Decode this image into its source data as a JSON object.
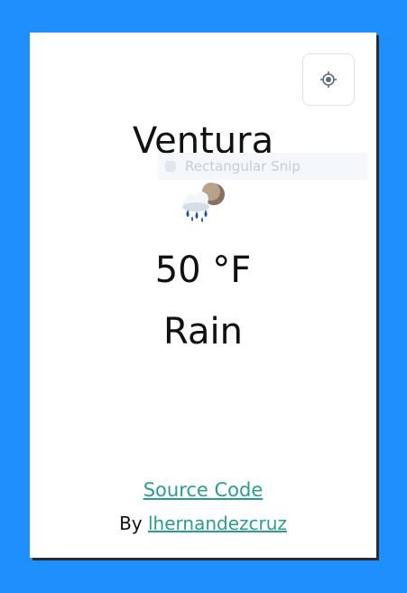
{
  "weather": {
    "city": "Ventura",
    "temperature": "50 °F",
    "condition": "Rain",
    "icon": "rain-cloud-icon"
  },
  "overlay": {
    "snip_text": "Rectangular Snip"
  },
  "footer": {
    "source_label": "Source Code",
    "by_label": "By",
    "author_label": "lhernandezcruz"
  },
  "controls": {
    "locate_icon": "crosshair-icon"
  },
  "colors": {
    "background": "#1e8ffd",
    "card": "#ffffff",
    "link": "#2a9d8f"
  }
}
